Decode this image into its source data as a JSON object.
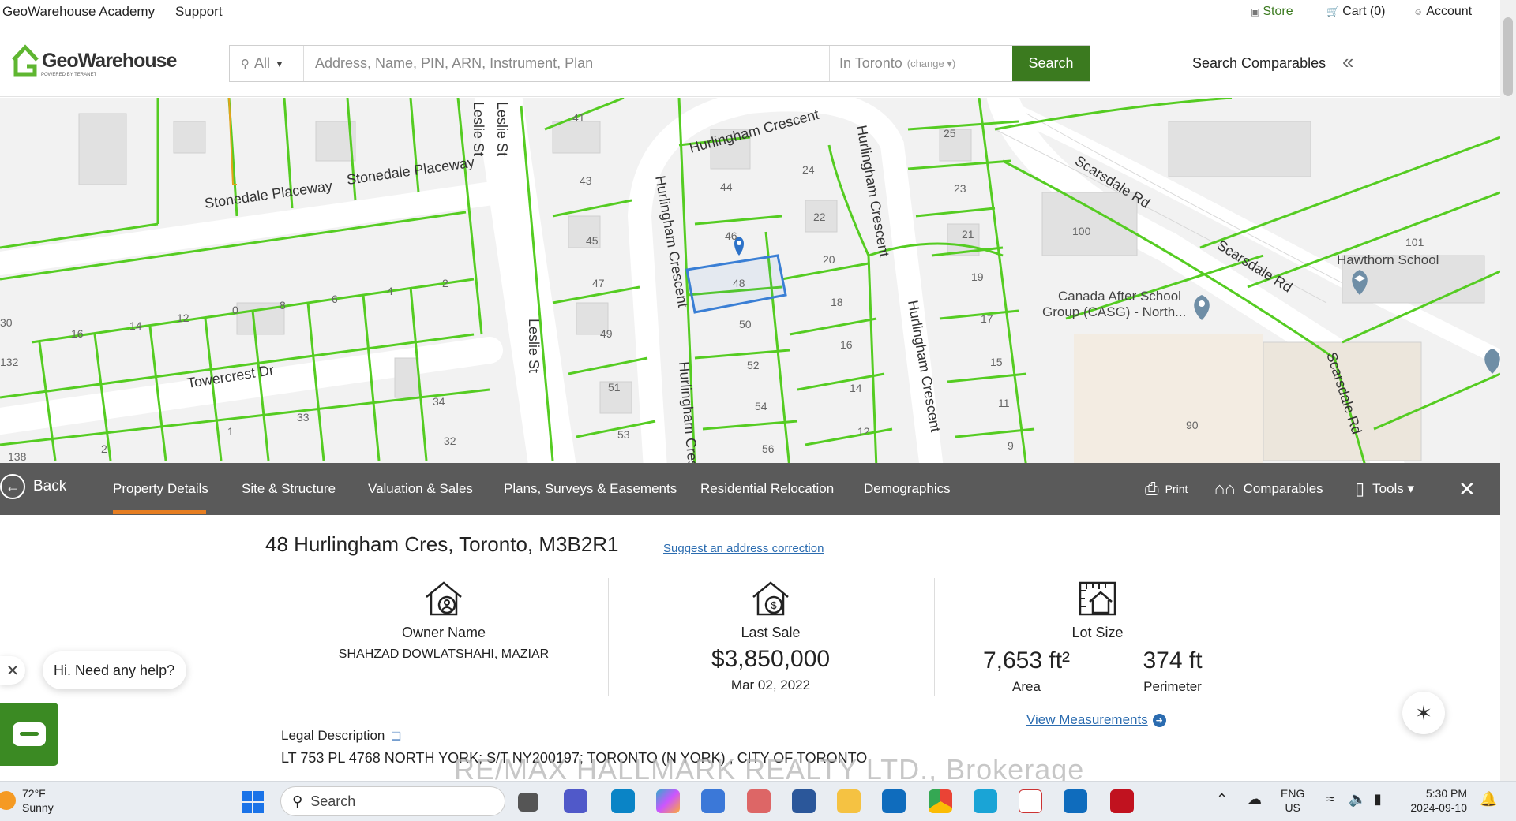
{
  "topbar": {
    "academy": "GeoWarehouse Academy",
    "support": "Support",
    "store": "Store",
    "cart": "Cart (0)",
    "account": "Account"
  },
  "header": {
    "logo_text": "GeoWarehouse",
    "logo_sub": "POWERED BY TERANET",
    "filter_label": "All",
    "search_placeholder": "Address, Name, PIN, ARN, Instrument, Plan",
    "location": "In Toronto",
    "location_change": "(change ▾)",
    "search_button": "Search",
    "search_comparables": "Search Comparables"
  },
  "map": {
    "streets": [
      "Leslie St",
      "Leslie St",
      "Leslie St",
      "Stonedale Placeway",
      "Stonedale Placeway",
      "Hurlingham Crescent",
      "Hurlingham Crescent",
      "Hurlingham Crescent",
      "Hurlingham Cres",
      "Hurlingham Crescent",
      "Scarsdale Rd",
      "Scarsdale Rd",
      "Scarsdale Rd",
      "Towercrest Dr",
      "Rd"
    ],
    "lots": [
      "41",
      "43",
      "45",
      "47",
      "49",
      "51",
      "53",
      "44",
      "46",
      "48",
      "50",
      "52",
      "54",
      "56",
      "24",
      "22",
      "20",
      "18",
      "16",
      "14",
      "12",
      "25",
      "23",
      "21",
      "19",
      "17",
      "15",
      "11",
      "9",
      "2",
      "4",
      "6",
      "8",
      "0",
      "12",
      "14",
      "16",
      "30",
      "132",
      "138",
      "34",
      "32",
      "33",
      "1",
      "2",
      "100",
      "101",
      "90"
    ],
    "pois": [
      "Canada After School",
      "Group (CASG) - North...",
      "Hawthorn School"
    ]
  },
  "nav": {
    "back": "Back",
    "tabs": [
      "Property Details",
      "Site & Structure",
      "Valuation & Sales",
      "Plans, Surveys & Easements",
      "Residential Relocation",
      "Demographics"
    ],
    "print": "Print",
    "comparables": "Comparables",
    "tools": "Tools ▾"
  },
  "property": {
    "address": "48 Hurlingham Cres, Toronto, M3B2R1",
    "suggest": "Suggest an address correction",
    "owner_label": "Owner Name",
    "owner_value": "SHAHZAD DOWLATSHAHI, MAZIAR",
    "last_sale_label": "Last Sale",
    "last_sale_price": "$3,850,000",
    "last_sale_date": "Mar 02, 2022",
    "lot_size_label": "Lot Size",
    "area_value": "7,653 ft²",
    "area_label": "Area",
    "perimeter_value": "374 ft",
    "perimeter_label": "Perimeter",
    "view_measurements": "View Measurements",
    "legal_label": "Legal Description",
    "legal_value": "LT 753 PL 4768 NORTH YORK; S/T NY200197; TORONTO (N YORK) , CITY OF TORONTO"
  },
  "chat": {
    "greeting": "Hi. Need any help?"
  },
  "watermark": "RE/MAX HALLMARK REALTY LTD., Brokerage",
  "taskbar": {
    "weather_temp": "72°F",
    "weather_desc": "Sunny",
    "search": "Search",
    "lang1": "ENG",
    "lang2": "US",
    "time": "5:30 PM",
    "date": "2024-09-10"
  },
  "colors": {
    "brand_green": "#3b7a1f",
    "lot_line": "#55cc22",
    "selected_lot": "#3a7fd5",
    "nav_bg": "#5a5a5a",
    "active_tab": "#e67e22"
  }
}
